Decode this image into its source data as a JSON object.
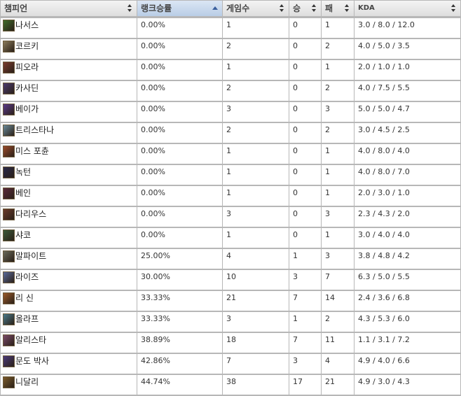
{
  "headers": {
    "champion": "챔피언",
    "rank_winrate": "랭크승률",
    "games": "게임수",
    "wins": "승",
    "losses": "패",
    "kda": "KDA"
  },
  "rows": [
    {
      "champion": "나서스",
      "winrate": "0.00%",
      "games": "1",
      "wins": "0",
      "losses": "1",
      "kda": "3.0 / 8.0 / 12.0",
      "portrait_color": "#3f6b2a"
    },
    {
      "champion": "코르키",
      "winrate": "0.00%",
      "games": "2",
      "wins": "0",
      "losses": "2",
      "kda": "4.0 / 5.0 / 3.5",
      "portrait_color": "#8a7a5a"
    },
    {
      "champion": "피오라",
      "winrate": "0.00%",
      "games": "1",
      "wins": "0",
      "losses": "1",
      "kda": "2.0 / 1.0 / 1.0",
      "portrait_color": "#7a3b2e"
    },
    {
      "champion": "카사딘",
      "winrate": "0.00%",
      "games": "2",
      "wins": "0",
      "losses": "2",
      "kda": "4.0 / 7.5 / 5.5",
      "portrait_color": "#4a3a6e"
    },
    {
      "champion": "베이가",
      "winrate": "0.00%",
      "games": "3",
      "wins": "0",
      "losses": "3",
      "kda": "5.0 / 5.0 / 4.7",
      "portrait_color": "#5a3a8a"
    },
    {
      "champion": "트리스타나",
      "winrate": "0.00%",
      "games": "2",
      "wins": "0",
      "losses": "2",
      "kda": "3.0 / 4.5 / 2.5",
      "portrait_color": "#6a8a9a"
    },
    {
      "champion": "미스 포츈",
      "winrate": "0.00%",
      "games": "1",
      "wins": "0",
      "losses": "1",
      "kda": "4.0 / 8.0 / 4.0",
      "portrait_color": "#9a4a2a"
    },
    {
      "champion": "녹턴",
      "winrate": "0.00%",
      "games": "1",
      "wins": "0",
      "losses": "1",
      "kda": "4.0 / 8.0 / 7.0",
      "portrait_color": "#2a2a4a"
    },
    {
      "champion": "베인",
      "winrate": "0.00%",
      "games": "1",
      "wins": "0",
      "losses": "1",
      "kda": "2.0 / 3.0 / 1.0",
      "portrait_color": "#5a2a3a"
    },
    {
      "champion": "다리우스",
      "winrate": "0.00%",
      "games": "3",
      "wins": "0",
      "losses": "3",
      "kda": "2.3 / 4.3 / 2.0",
      "portrait_color": "#6a3a2a"
    },
    {
      "champion": "샤코",
      "winrate": "0.00%",
      "games": "1",
      "wins": "0",
      "losses": "1",
      "kda": "3.0 / 4.0 / 4.0",
      "portrait_color": "#3a5a3a"
    },
    {
      "champion": "말파이트",
      "winrate": "25.00%",
      "games": "4",
      "wins": "1",
      "losses": "3",
      "kda": "3.8 / 4.8 / 4.2",
      "portrait_color": "#6a6a5a"
    },
    {
      "champion": "라이즈",
      "winrate": "30.00%",
      "games": "10",
      "wins": "3",
      "losses": "7",
      "kda": "6.3 / 5.0 / 5.5",
      "portrait_color": "#5a6a9a"
    },
    {
      "champion": "리 신",
      "winrate": "33.33%",
      "games": "21",
      "wins": "7",
      "losses": "14",
      "kda": "2.4 / 3.6 / 6.8",
      "portrait_color": "#9a5a2a"
    },
    {
      "champion": "올라프",
      "winrate": "33.33%",
      "games": "3",
      "wins": "1",
      "losses": "2",
      "kda": "4.3 / 5.3 / 6.0",
      "portrait_color": "#4a7a8a"
    },
    {
      "champion": "알리스타",
      "winrate": "38.89%",
      "games": "18",
      "wins": "7",
      "losses": "11",
      "kda": "1.1 / 3.1 / 7.2",
      "portrait_color": "#7a4a6a"
    },
    {
      "champion": "문도 박사",
      "winrate": "42.86%",
      "games": "7",
      "wins": "3",
      "losses": "4",
      "kda": "4.9 / 4.0 / 6.6",
      "portrait_color": "#4a3a7a"
    },
    {
      "champion": "니달리",
      "winrate": "44.74%",
      "games": "38",
      "wins": "17",
      "losses": "21",
      "kda": "4.9 / 3.0 / 4.3",
      "portrait_color": "#7a5a2a"
    }
  ]
}
